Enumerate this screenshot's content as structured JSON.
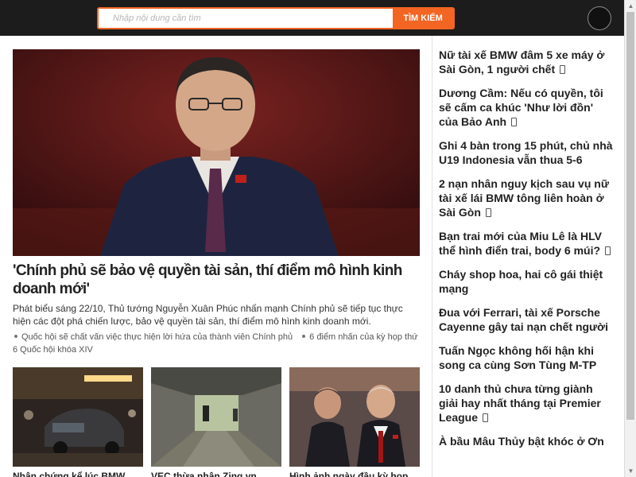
{
  "search": {
    "placeholder": "Nhập nội dung cần tìm",
    "button_label": "TÌM KIẾM"
  },
  "featured": {
    "title": "'Chính phủ sẽ bảo vệ quyền tài sản, thí điểm mô hình kinh doanh mới'",
    "description": "Phát biểu sáng 22/10, Thủ tướng Nguyễn Xuân Phúc nhấn mạnh Chính phủ sẽ tiếp tục thực hiện các đột phá chiến lược, bảo vệ quyền tài sản, thí điểm mô hình kinh doanh mới.",
    "related": [
      "Quốc hội sẽ chất vấn việc thực hiện lời hứa của thành viên Chính phủ",
      "6 điểm nhấn của kỳ họp thứ 6 Quốc hội khóa XIV"
    ]
  },
  "thumbnails": [
    {
      "title": "Nhân chứng kể lúc BMW"
    },
    {
      "title": "VEC thừa nhận Zing.vn"
    },
    {
      "title": "Hình ảnh ngày đầu kỳ họp"
    }
  ],
  "sidebar": {
    "items": [
      {
        "title": "Nữ tài xế BMW đâm 5 xe máy ở Sài Gòn, 1 người chết",
        "icon": "video-icon"
      },
      {
        "title": "Dương Cầm: Nếu có quyền, tôi sẽ cấm ca khúc 'Như lời đồn' của Bảo Anh",
        "icon": "video-icon"
      },
      {
        "title": "Ghi 4 bàn trong 15 phút, chủ nhà U19 Indonesia vẫn thua 5-6",
        "icon": ""
      },
      {
        "title": "2 nạn nhân nguy kịch sau vụ nữ tài xế lái BMW tông liên hoàn ở Sài Gòn",
        "icon": "video-icon"
      },
      {
        "title": "Bạn trai mới của Miu Lê là HLV thể hình điển trai, body 6 múi?",
        "icon": "video-icon"
      },
      {
        "title": "Cháy shop hoa, hai cô gái thiệt mạng",
        "icon": ""
      },
      {
        "title": "Đua với Ferrari, tài xế Porsche Cayenne gây tai nạn chết người",
        "icon": ""
      },
      {
        "title": "Tuấn Ngọc không hối hận khi song ca cùng Sơn Tùng M-TP",
        "icon": ""
      },
      {
        "title": "10 danh thủ chưa từng giành giải hay nhất tháng tại Premier League",
        "icon": "video-icon"
      },
      {
        "title": "À bầu Mâu Thủy bật khóc ở Ơn",
        "icon": ""
      }
    ]
  },
  "colors": {
    "accent": "#f26522",
    "topbar": "#1c1c1c"
  }
}
